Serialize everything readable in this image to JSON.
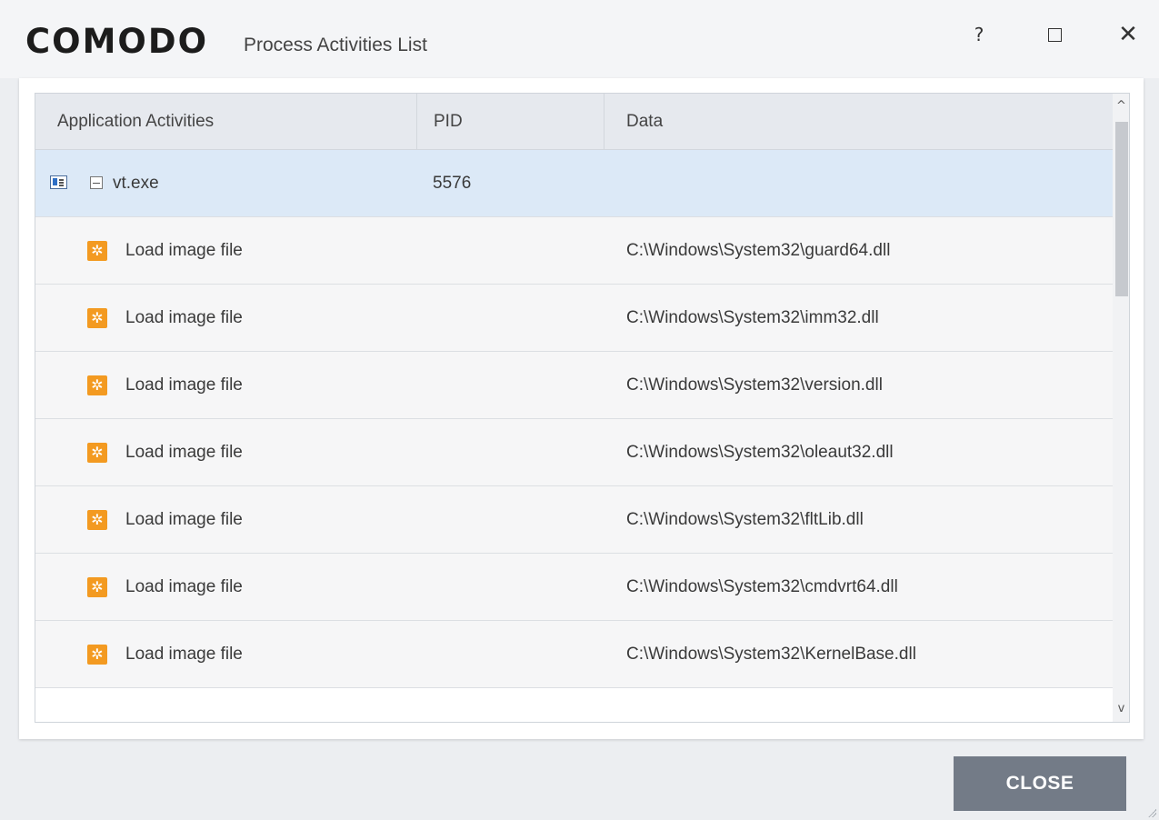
{
  "window": {
    "brand": "COMODO",
    "title": "Process Activities List",
    "help_label": "?",
    "close_label": "✕"
  },
  "table": {
    "columns": [
      "Application Activities",
      "PID",
      "Data"
    ],
    "parent": {
      "name": "vt.exe",
      "pid": "5576"
    },
    "children": [
      {
        "activity": "Load image file",
        "data": "C:\\Windows\\System32\\guard64.dll"
      },
      {
        "activity": "Load image file",
        "data": "C:\\Windows\\System32\\imm32.dll"
      },
      {
        "activity": "Load image file",
        "data": "C:\\Windows\\System32\\version.dll"
      },
      {
        "activity": "Load image file",
        "data": "C:\\Windows\\System32\\oleaut32.dll"
      },
      {
        "activity": "Load image file",
        "data": "C:\\Windows\\System32\\fltLib.dll"
      },
      {
        "activity": "Load image file",
        "data": "C:\\Windows\\System32\\cmdvrt64.dll"
      },
      {
        "activity": "Load image file",
        "data": "C:\\Windows\\System32\\KernelBase.dll"
      }
    ]
  },
  "scrollbar": {
    "up": "^",
    "down": "v"
  },
  "footer": {
    "close_button": "CLOSE"
  },
  "icons": {
    "app": "application-window-icon",
    "collapse": "collapse-minus-icon",
    "activity": "orange-gear-icon",
    "activity_glyph": "✲"
  },
  "colors": {
    "accent_selected_row": "#dce9f7",
    "activity_icon": "#f39a21",
    "close_button": "#737b87"
  }
}
